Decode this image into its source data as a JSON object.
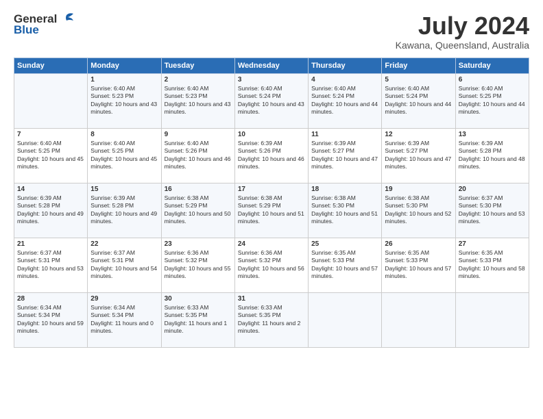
{
  "logo": {
    "general": "General",
    "blue": "Blue"
  },
  "title": {
    "month_year": "July 2024",
    "location": "Kawana, Queensland, Australia"
  },
  "header_days": [
    "Sunday",
    "Monday",
    "Tuesday",
    "Wednesday",
    "Thursday",
    "Friday",
    "Saturday"
  ],
  "weeks": [
    [
      {
        "day": "",
        "sunrise": "",
        "sunset": "",
        "daylight": ""
      },
      {
        "day": "1",
        "sunrise": "Sunrise: 6:40 AM",
        "sunset": "Sunset: 5:23 PM",
        "daylight": "Daylight: 10 hours and 43 minutes."
      },
      {
        "day": "2",
        "sunrise": "Sunrise: 6:40 AM",
        "sunset": "Sunset: 5:23 PM",
        "daylight": "Daylight: 10 hours and 43 minutes."
      },
      {
        "day": "3",
        "sunrise": "Sunrise: 6:40 AM",
        "sunset": "Sunset: 5:24 PM",
        "daylight": "Daylight: 10 hours and 43 minutes."
      },
      {
        "day": "4",
        "sunrise": "Sunrise: 6:40 AM",
        "sunset": "Sunset: 5:24 PM",
        "daylight": "Daylight: 10 hours and 44 minutes."
      },
      {
        "day": "5",
        "sunrise": "Sunrise: 6:40 AM",
        "sunset": "Sunset: 5:24 PM",
        "daylight": "Daylight: 10 hours and 44 minutes."
      },
      {
        "day": "6",
        "sunrise": "Sunrise: 6:40 AM",
        "sunset": "Sunset: 5:25 PM",
        "daylight": "Daylight: 10 hours and 44 minutes."
      }
    ],
    [
      {
        "day": "7",
        "sunrise": "Sunrise: 6:40 AM",
        "sunset": "Sunset: 5:25 PM",
        "daylight": "Daylight: 10 hours and 45 minutes."
      },
      {
        "day": "8",
        "sunrise": "Sunrise: 6:40 AM",
        "sunset": "Sunset: 5:25 PM",
        "daylight": "Daylight: 10 hours and 45 minutes."
      },
      {
        "day": "9",
        "sunrise": "Sunrise: 6:40 AM",
        "sunset": "Sunset: 5:26 PM",
        "daylight": "Daylight: 10 hours and 46 minutes."
      },
      {
        "day": "10",
        "sunrise": "Sunrise: 6:39 AM",
        "sunset": "Sunset: 5:26 PM",
        "daylight": "Daylight: 10 hours and 46 minutes."
      },
      {
        "day": "11",
        "sunrise": "Sunrise: 6:39 AM",
        "sunset": "Sunset: 5:27 PM",
        "daylight": "Daylight: 10 hours and 47 minutes."
      },
      {
        "day": "12",
        "sunrise": "Sunrise: 6:39 AM",
        "sunset": "Sunset: 5:27 PM",
        "daylight": "Daylight: 10 hours and 47 minutes."
      },
      {
        "day": "13",
        "sunrise": "Sunrise: 6:39 AM",
        "sunset": "Sunset: 5:28 PM",
        "daylight": "Daylight: 10 hours and 48 minutes."
      }
    ],
    [
      {
        "day": "14",
        "sunrise": "Sunrise: 6:39 AM",
        "sunset": "Sunset: 5:28 PM",
        "daylight": "Daylight: 10 hours and 49 minutes."
      },
      {
        "day": "15",
        "sunrise": "Sunrise: 6:39 AM",
        "sunset": "Sunset: 5:28 PM",
        "daylight": "Daylight: 10 hours and 49 minutes."
      },
      {
        "day": "16",
        "sunrise": "Sunrise: 6:38 AM",
        "sunset": "Sunset: 5:29 PM",
        "daylight": "Daylight: 10 hours and 50 minutes."
      },
      {
        "day": "17",
        "sunrise": "Sunrise: 6:38 AM",
        "sunset": "Sunset: 5:29 PM",
        "daylight": "Daylight: 10 hours and 51 minutes."
      },
      {
        "day": "18",
        "sunrise": "Sunrise: 6:38 AM",
        "sunset": "Sunset: 5:30 PM",
        "daylight": "Daylight: 10 hours and 51 minutes."
      },
      {
        "day": "19",
        "sunrise": "Sunrise: 6:38 AM",
        "sunset": "Sunset: 5:30 PM",
        "daylight": "Daylight: 10 hours and 52 minutes."
      },
      {
        "day": "20",
        "sunrise": "Sunrise: 6:37 AM",
        "sunset": "Sunset: 5:30 PM",
        "daylight": "Daylight: 10 hours and 53 minutes."
      }
    ],
    [
      {
        "day": "21",
        "sunrise": "Sunrise: 6:37 AM",
        "sunset": "Sunset: 5:31 PM",
        "daylight": "Daylight: 10 hours and 53 minutes."
      },
      {
        "day": "22",
        "sunrise": "Sunrise: 6:37 AM",
        "sunset": "Sunset: 5:31 PM",
        "daylight": "Daylight: 10 hours and 54 minutes."
      },
      {
        "day": "23",
        "sunrise": "Sunrise: 6:36 AM",
        "sunset": "Sunset: 5:32 PM",
        "daylight": "Daylight: 10 hours and 55 minutes."
      },
      {
        "day": "24",
        "sunrise": "Sunrise: 6:36 AM",
        "sunset": "Sunset: 5:32 PM",
        "daylight": "Daylight: 10 hours and 56 minutes."
      },
      {
        "day": "25",
        "sunrise": "Sunrise: 6:35 AM",
        "sunset": "Sunset: 5:33 PM",
        "daylight": "Daylight: 10 hours and 57 minutes."
      },
      {
        "day": "26",
        "sunrise": "Sunrise: 6:35 AM",
        "sunset": "Sunset: 5:33 PM",
        "daylight": "Daylight: 10 hours and 57 minutes."
      },
      {
        "day": "27",
        "sunrise": "Sunrise: 6:35 AM",
        "sunset": "Sunset: 5:33 PM",
        "daylight": "Daylight: 10 hours and 58 minutes."
      }
    ],
    [
      {
        "day": "28",
        "sunrise": "Sunrise: 6:34 AM",
        "sunset": "Sunset: 5:34 PM",
        "daylight": "Daylight: 10 hours and 59 minutes."
      },
      {
        "day": "29",
        "sunrise": "Sunrise: 6:34 AM",
        "sunset": "Sunset: 5:34 PM",
        "daylight": "Daylight: 11 hours and 0 minutes."
      },
      {
        "day": "30",
        "sunrise": "Sunrise: 6:33 AM",
        "sunset": "Sunset: 5:35 PM",
        "daylight": "Daylight: 11 hours and 1 minute."
      },
      {
        "day": "31",
        "sunrise": "Sunrise: 6:33 AM",
        "sunset": "Sunset: 5:35 PM",
        "daylight": "Daylight: 11 hours and 2 minutes."
      },
      {
        "day": "",
        "sunrise": "",
        "sunset": "",
        "daylight": ""
      },
      {
        "day": "",
        "sunrise": "",
        "sunset": "",
        "daylight": ""
      },
      {
        "day": "",
        "sunrise": "",
        "sunset": "",
        "daylight": ""
      }
    ]
  ]
}
